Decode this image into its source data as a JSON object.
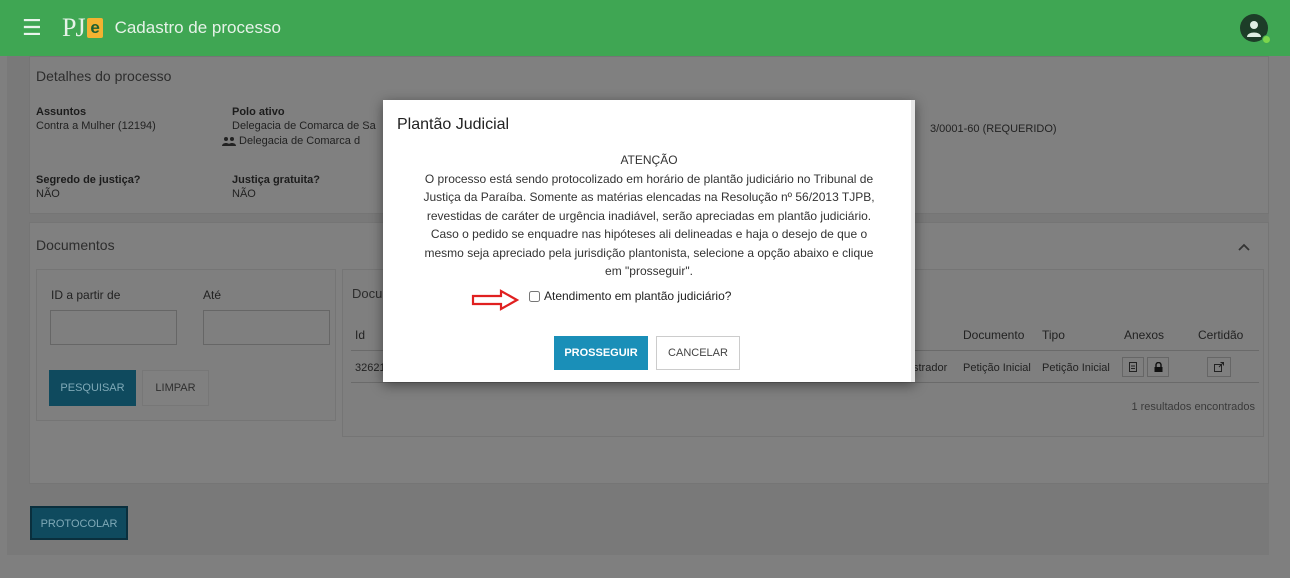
{
  "header": {
    "menu_icon": "hamburger-icon",
    "logo_text": "PJ",
    "logo_letter": "e",
    "title": "Cadastro de processo",
    "avatar_icon": "user-icon"
  },
  "details": {
    "title": "Detalhes do processo",
    "assuntos_label": "Assuntos",
    "assuntos_value": "Contra a Mulher (12194)",
    "polo_ativo_label": "Polo ativo",
    "polo_ativo_value": "Delegacia de Comarca de Sa",
    "polo_ativo_sub": "Delegacia de Comarca d",
    "polo_passivo_value": "3/0001-60 (REQUERIDO)",
    "segredo_label": "Segredo de justiça?",
    "segredo_value": "NÃO",
    "gratuita_label": "Justiça gratuita?",
    "gratuita_value": "NÃO"
  },
  "documents": {
    "title": "Documentos",
    "filter": {
      "id_label": "ID a partir de",
      "ate_label": "Até",
      "search_button": "PESQUISAR",
      "clear_button": "LIMPAR"
    },
    "list_title": "Docu",
    "columns": {
      "id": "Id",
      "documento": "Documento",
      "tipo": "Tipo",
      "anexos": "Anexos",
      "certidao": "Certidão"
    },
    "row": {
      "id": "32621",
      "author": "strador",
      "documento": "Petição Inicial",
      "tipo": "Petição Inicial"
    },
    "result_count": "1 resultados encontrados"
  },
  "protocolar_button": "PROTOCOLAR",
  "modal": {
    "title": "Plantão Judicial",
    "attention": "ATENÇÃO",
    "lines": [
      "O processo está sendo protocolizado em horário de plantão judiciário no Tribunal de",
      "Justiça da Paraíba. Somente as matérias elencadas na Resolução nº 56/2013 TJPB,",
      "revestidas de caráter de urgência inadiável, serão apreciadas em plantão judiciário.",
      "Caso o pedido se enquadre nas hipóteses ali delineadas e haja o desejo de que o",
      "mesmo seja apreciado pela jurisdição plantonista, selecione a opção abaixo e clique",
      "em \"prosseguir\"."
    ],
    "checkbox_label": "Atendimento em plantão judiciário?",
    "proceed_button": "PROSSEGUIR",
    "cancel_button": "CANCELAR"
  },
  "colors": {
    "header_green": "#3fa653",
    "primary_blue": "#1a8fb8",
    "arrow_red": "#e02020"
  }
}
